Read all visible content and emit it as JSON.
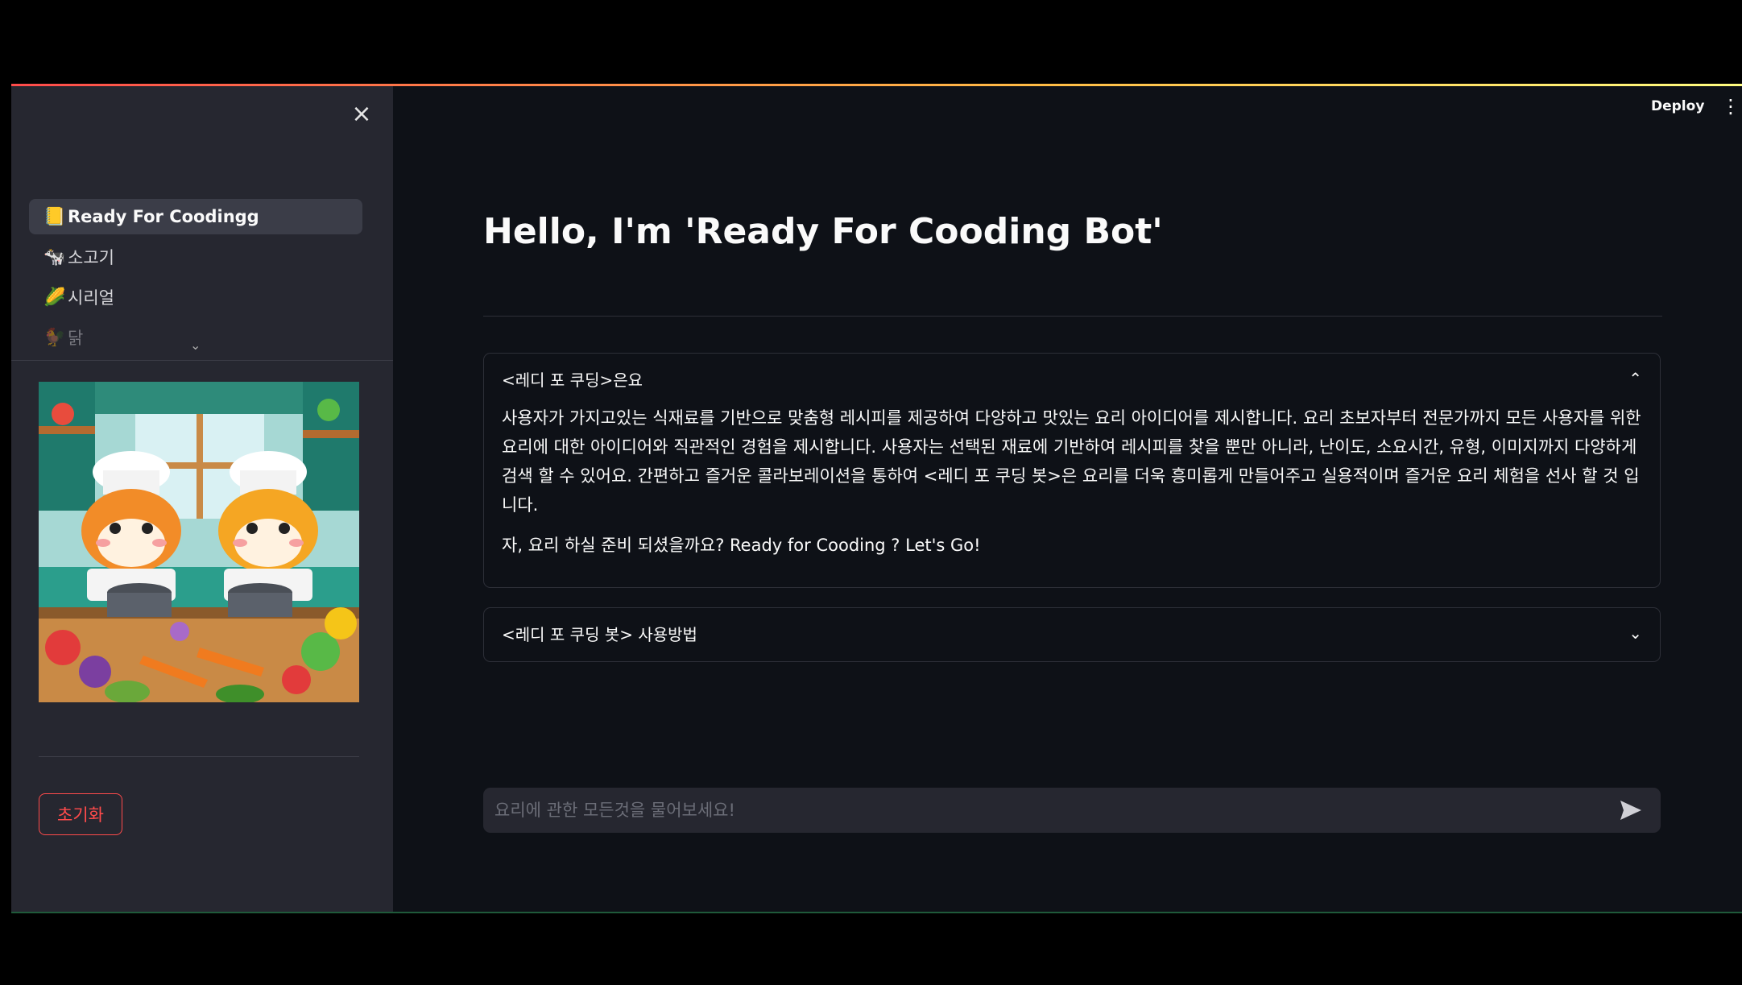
{
  "sidebar": {
    "close_icon": "×",
    "nav_items": [
      {
        "icon": "📒",
        "label": "Ready For Coodingg",
        "active": true
      },
      {
        "icon": "🐄",
        "label": "소고기"
      },
      {
        "icon": "🌽",
        "label": "시리얼"
      },
      {
        "icon": "🐓",
        "label": "닭"
      }
    ],
    "reset_label": "초기화"
  },
  "header": {
    "deploy_label": "Deploy",
    "menu_icon": "⋮"
  },
  "main": {
    "title": "Hello, I'm 'Ready For Cooding Bot'",
    "expanders": [
      {
        "label": "<레디 포 쿠딩>은요",
        "expanded": true,
        "paragraphs": [
          "사용자가 가지고있는 식재료를 기반으로 맞춤형 레시피를 제공하여 다양하고 맛있는 요리 아이디어를 제시합니다. 요리 초보자부터 전문가까지 모든 사용자를 위한 요리에 대한 아이디어와 직관적인 경험을 제시합니다. 사용자는 선택된 재료에 기반하여 레시피를 찾을 뿐만 아니라, 난이도, 소요시간, 유형, 이미지까지 다양하게 검색 할 수 있어요. 간편하고 즐거운 콜라보레이션을 통하여 <레디 포 쿠딩 봇>은 요리를 더욱 흥미롭게 만들어주고 실용적이며 즐거운 요리 체험을 선사 할 것 입니다.",
          "자, 요리 하실 준비 되셨을까요? Ready for Cooding ? Let's Go!"
        ]
      },
      {
        "label": "<레디 포 쿠딩 봇> 사용방법",
        "expanded": false
      }
    ],
    "chat": {
      "placeholder": "요리에 관한 모든것을 물어보세요!"
    }
  },
  "colors": {
    "accent": "#ff4b4b",
    "background": "#0e1117",
    "sidebar": "#262730"
  }
}
